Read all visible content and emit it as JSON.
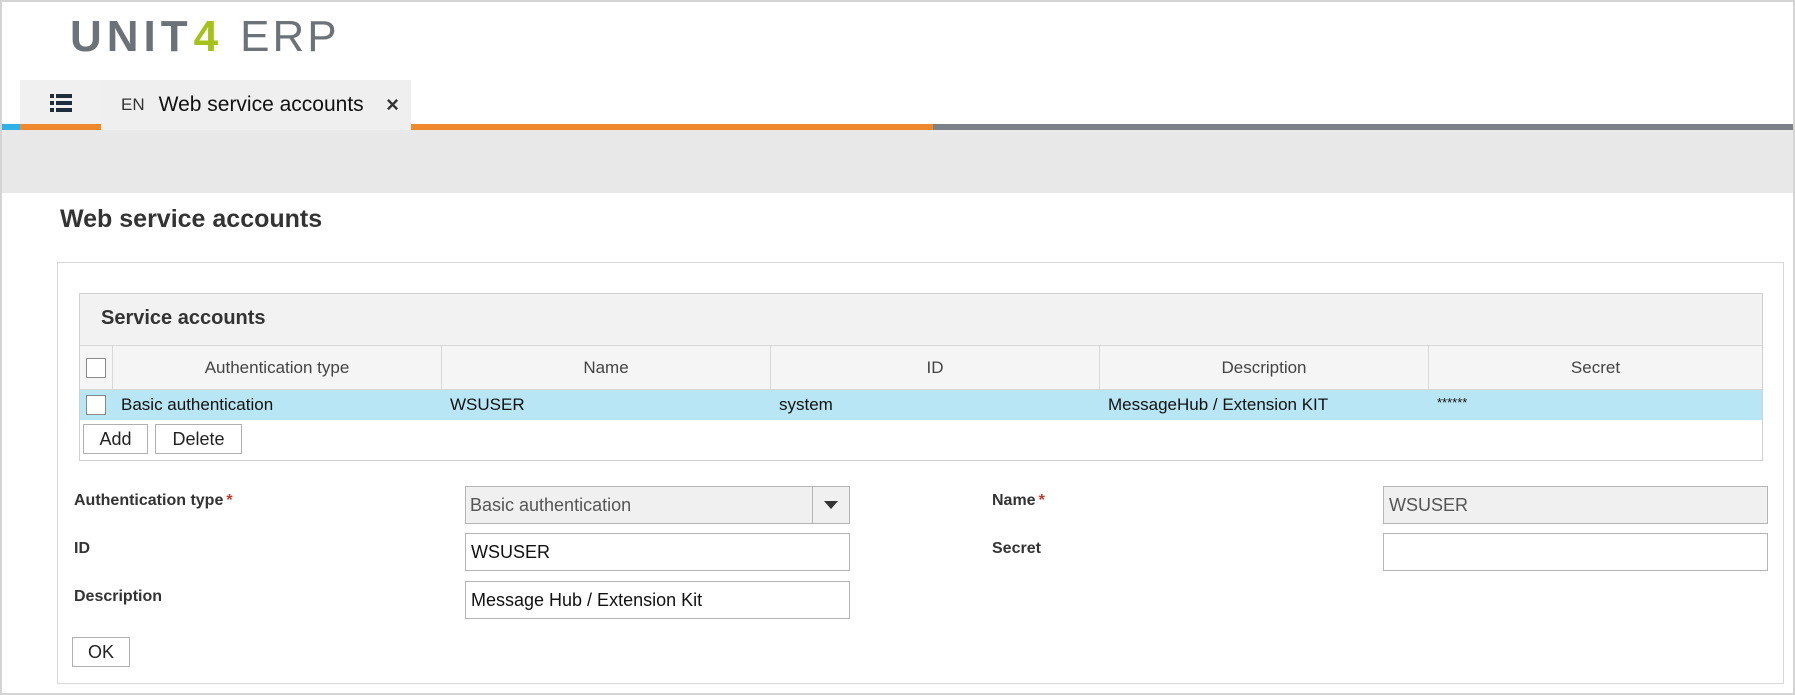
{
  "logo": {
    "unit": "UNIT",
    "four": "4",
    "erp": "ERP"
  },
  "tabs": {
    "active": {
      "lang": "EN",
      "title": "Web service accounts",
      "close": "×"
    }
  },
  "colors": {
    "brand_orange": "#f0892d",
    "brand_blue": "#2fb2e6",
    "row_selected": "#b8e6f5",
    "logo_green": "#a6c11a"
  },
  "page": {
    "title": "Web service accounts"
  },
  "grid": {
    "title": "Service accounts",
    "columns": [
      "Authentication type",
      "Name",
      "ID",
      "Description",
      "Secret"
    ],
    "rows": [
      {
        "auth_type": "Basic authentication",
        "name": "WSUSER",
        "id": "system",
        "description": "MessageHub / Extension KIT",
        "secret": "******"
      }
    ],
    "add_label": "Add",
    "delete_label": "Delete"
  },
  "form": {
    "auth_type_label": "Authentication type",
    "auth_type_value": "Basic authentication",
    "name_label": "Name",
    "name_value": "WSUSER",
    "id_label": "ID",
    "id_value": "WSUSER",
    "secret_label": "Secret",
    "secret_value": "",
    "description_label": "Description",
    "description_value": "Message Hub / Extension Kit",
    "required_mark": "*",
    "ok_label": "OK"
  }
}
